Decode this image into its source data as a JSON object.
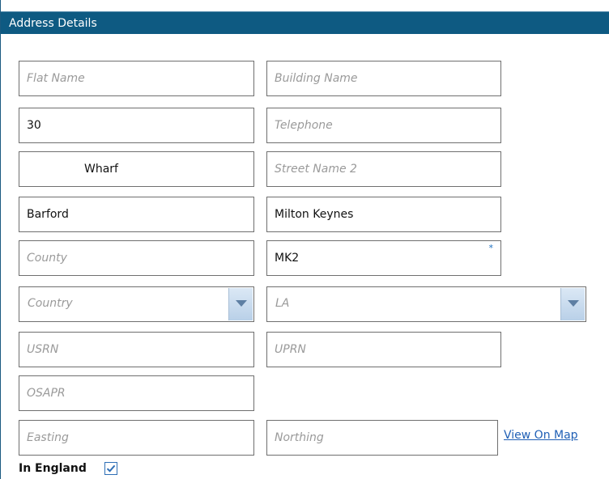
{
  "panel": {
    "title": "Address Details"
  },
  "fields": {
    "flat_name": {
      "value": "",
      "placeholder": "Flat Name"
    },
    "building_name": {
      "value": "",
      "placeholder": "Building Name"
    },
    "house_number": {
      "value": "30",
      "placeholder": ""
    },
    "telephone": {
      "value": "",
      "placeholder": "Telephone"
    },
    "street_name": {
      "value": "Wharf",
      "placeholder": ""
    },
    "street_name_2": {
      "value": "",
      "placeholder": "Street Name 2"
    },
    "locality": {
      "value": "Barford",
      "placeholder": ""
    },
    "town": {
      "value": "Milton Keynes",
      "placeholder": ""
    },
    "county": {
      "value": "",
      "placeholder": "County"
    },
    "postcode": {
      "value": "MK2",
      "placeholder": "",
      "required_marker": "*"
    },
    "country": {
      "selected": "Country"
    },
    "la": {
      "selected": "LA"
    },
    "usrn": {
      "value": "",
      "placeholder": "USRN"
    },
    "uprn": {
      "value": "",
      "placeholder": "UPRN"
    },
    "osapr": {
      "value": "",
      "placeholder": "OSAPR"
    },
    "easting": {
      "value": "",
      "placeholder": "Easting"
    },
    "northing": {
      "value": "",
      "placeholder": "Northing"
    }
  },
  "view_on_map": {
    "label": "View On Map"
  },
  "in_england": {
    "label": "In England",
    "checked": true
  },
  "colors": {
    "header": "#0e5a82",
    "link": "#1f5fb5",
    "checkmark": "#2f6fb6"
  }
}
